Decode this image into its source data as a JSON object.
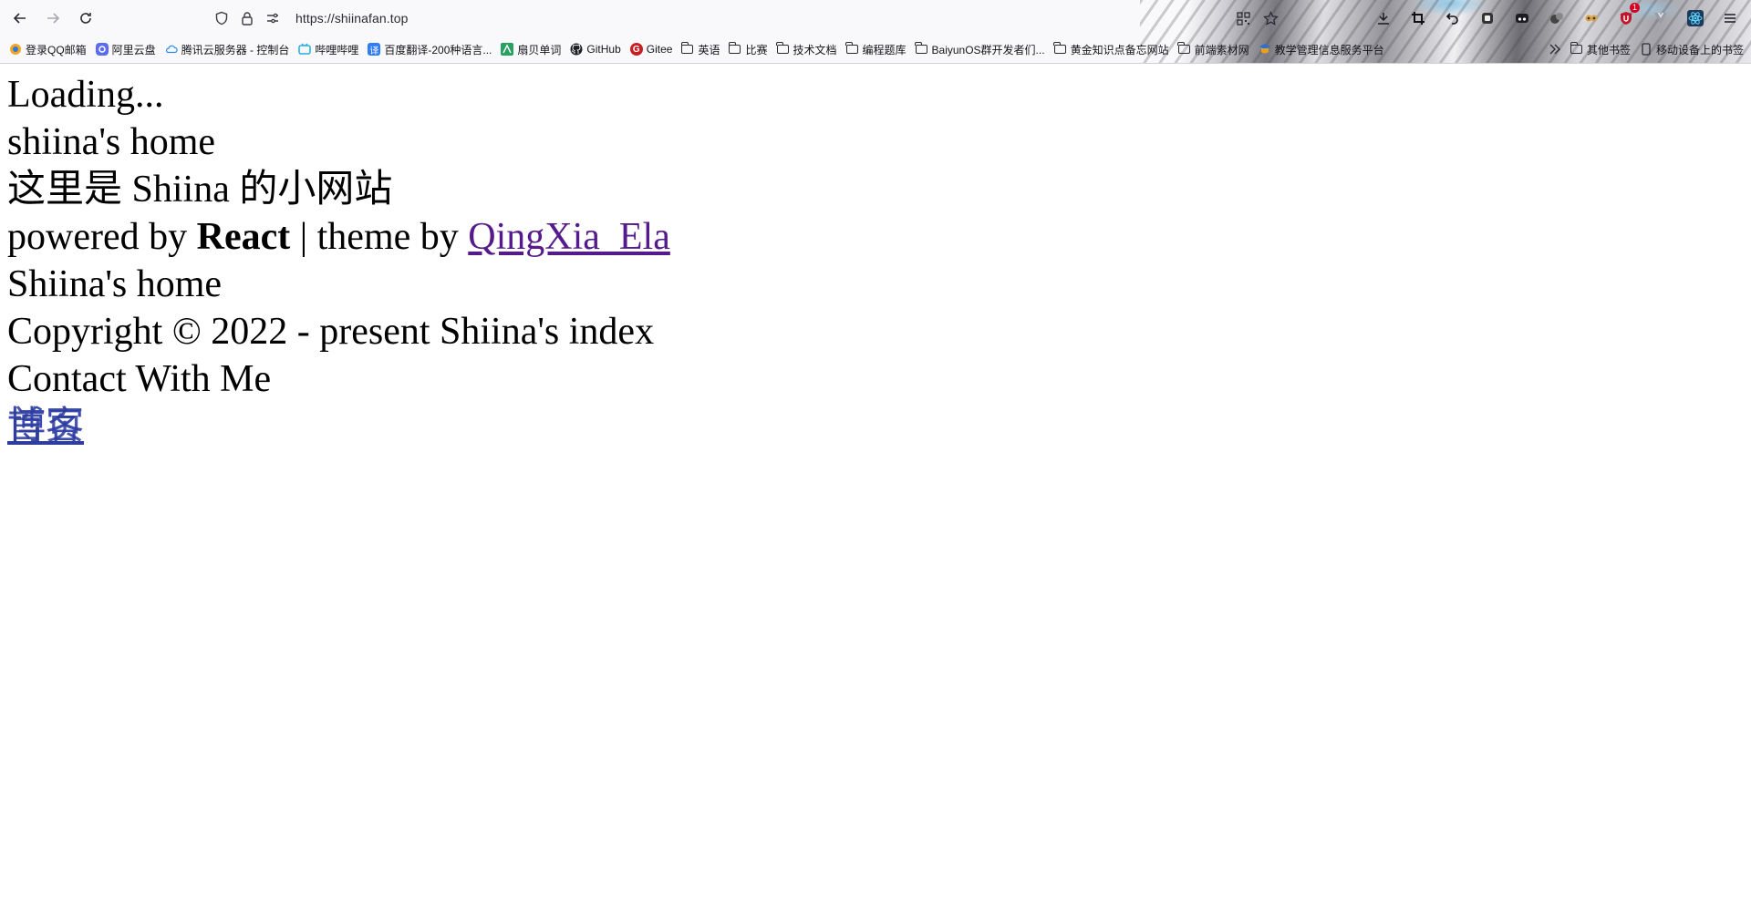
{
  "browser": {
    "url": "https://shiinafan.top",
    "icons": {
      "back": "arrow-left-icon",
      "forward": "arrow-right-icon",
      "reload": "reload-icon",
      "shield": "shield-icon",
      "lock": "lock-icon",
      "permissions": "permissions-icon",
      "qr": "qr-code-icon",
      "star": "star-icon"
    },
    "extensions": [
      {
        "name": "download-icon",
        "glyph": "⤓"
      },
      {
        "name": "crop-icon",
        "glyph": "⌗"
      },
      {
        "name": "undo-icon",
        "glyph": "↶"
      },
      {
        "name": "screenshot-icon",
        "glyph": "◙"
      },
      {
        "name": "container-icon",
        "glyph": "▣"
      },
      {
        "name": "ball-icon",
        "glyph": "●"
      },
      {
        "name": "owl-icon",
        "glyph": "◉"
      },
      {
        "name": "ublock-icon",
        "glyph": "⛉",
        "badge": "1"
      },
      {
        "name": "vue-devtools-icon",
        "glyph": "▼"
      },
      {
        "name": "react-devtools-icon",
        "glyph": "⚛"
      },
      {
        "name": "menu-icon",
        "glyph": "≡"
      }
    ]
  },
  "bookmarks": {
    "items": [
      {
        "label": "登录QQ邮箱",
        "icon": "qq-mail-icon",
        "color": "#f4a623",
        "glyph": "●"
      },
      {
        "label": "阿里云盘",
        "icon": "aliyun-drive-icon",
        "color": "#5b6cf0",
        "glyph": "◎"
      },
      {
        "label": "腾讯云服务器 - 控制台",
        "icon": "tencent-cloud-icon",
        "color": "#2a8cf0",
        "glyph": "☁"
      },
      {
        "label": "哔哩哔哩",
        "icon": "bilibili-icon",
        "color": "#23ade5",
        "glyph": "▣"
      },
      {
        "label": "百度翻译-200种语言...",
        "icon": "baidu-translate-icon",
        "color": "#2f7cf6",
        "glyph": "译"
      },
      {
        "label": "扇贝单词",
        "icon": "shanbay-icon",
        "color": "#28a060",
        "glyph": "▤"
      },
      {
        "label": "GitHub",
        "icon": "github-icon",
        "color": "#1b1f23",
        "glyph": "●"
      },
      {
        "label": "Gitee",
        "icon": "gitee-icon",
        "color": "#c71d23",
        "glyph": "G"
      }
    ],
    "folders": [
      "英语",
      "比赛",
      "技术文档",
      "编程题库",
      "BaiyunOS群开发者们...",
      "黄金知识点备忘网站",
      "前端素材网"
    ],
    "last_item": {
      "label": "教学管理信息服务平台",
      "icon": "school-icon"
    },
    "overflow_icon": "chevron-double-right-icon",
    "other_bookmarks": "其他书签",
    "mobile_bookmarks": "移动设备上的书签"
  },
  "page": {
    "loading": "Loading...",
    "home_title": "shiina's home",
    "subtitle": "这里是 Shiina 的小网站",
    "powered_prefix": "powered by ",
    "powered_framework": "React",
    "theme_sep": " | theme by ",
    "theme_author": "QingXia_Ela",
    "home_title_2": "Shiina's home",
    "copyright": "Copyright © 2022 - present Shiina's index",
    "contact": "Contact With Me",
    "overlap_links": [
      "博客",
      "首页"
    ]
  }
}
